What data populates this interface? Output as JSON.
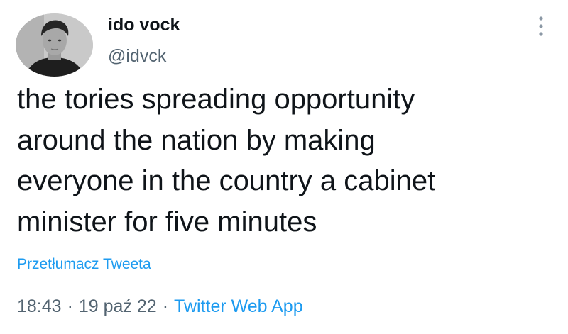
{
  "author": {
    "display_name": "ido vock",
    "handle": "@idvck",
    "avatar": "profile-photo"
  },
  "menu": {
    "icon": "more-vertical-icon"
  },
  "tweet": {
    "lines": [
      "the tories spreading opportunity",
      "around the nation by making",
      "everyone in the country a cabinet",
      "minister for five minutes"
    ]
  },
  "translate": {
    "label": "Przetłumacz Tweeta"
  },
  "meta": {
    "time": "18:43",
    "separator": "·",
    "date": "19 paź 22",
    "source": "Twitter Web App"
  },
  "colors": {
    "text": "#0f1419",
    "secondary": "#536471",
    "link": "#1d9bf0"
  }
}
